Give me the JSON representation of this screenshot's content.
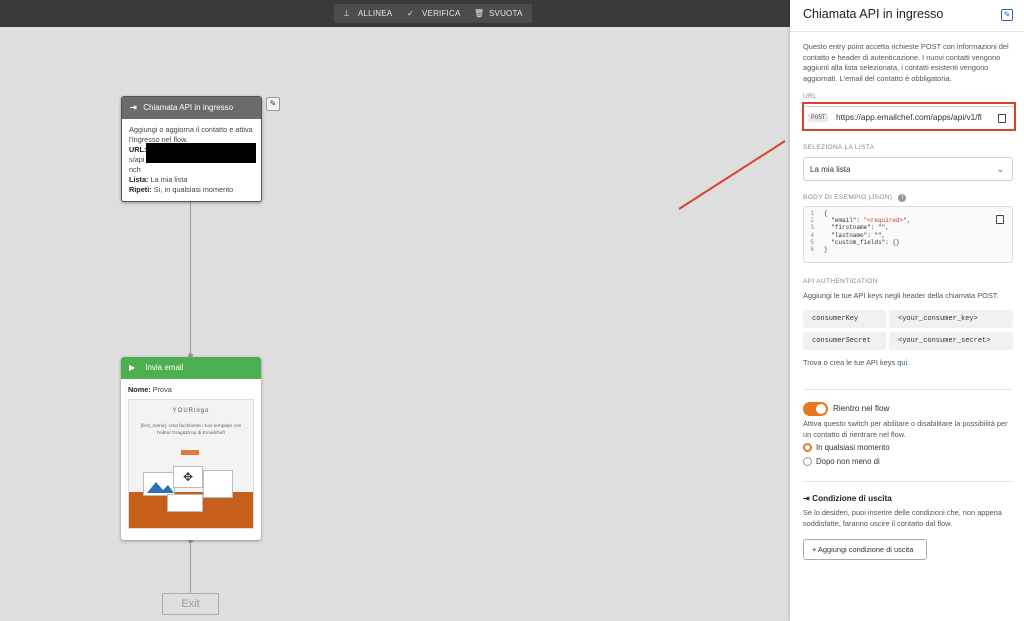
{
  "toolbar": {
    "align_label": "ALLINEA",
    "verify_label": "VERIFICA",
    "clear_label": "SVUOTA"
  },
  "flow": {
    "entry_node": {
      "title": "Chiamata API in ingresso",
      "description": "Aggiungi o aggiorna il contatto e attiva l'ingresso nel flow.",
      "url_label": "URL:",
      "url_partial_1": "s/api",
      "url_partial_2": "nch",
      "list_label": "Lista:",
      "list_value": "La mia lista",
      "repeat_label": "Ripeti:",
      "repeat_value": "Sì, in qualsiasi momento"
    },
    "email_node": {
      "title": "Invia email",
      "name_label": "Nome:",
      "name_value": "Prova",
      "preview": {
        "logo": "YOURlogo",
        "text": "[first_name], crea facilmente i tuoi template con l'editor Drag&Drop di Emailchef!"
      }
    },
    "exit_label": "Exit"
  },
  "panel": {
    "title": "Chiamata API in ingresso",
    "intro": "Questo entry point accetta richieste POST con informazioni del contatto e header di autenticazione. I nuovi contatti vengono aggiunti alla lista selezionata, i contatti esistenti vengono aggiornati. L'email del contatto è obbligatoria.",
    "url_section_label": "URL",
    "method": "POST",
    "url_value": "https://app.emailchef.com/apps/api/v1/fl",
    "list_section_label": "SELEZIONA LA LISTA",
    "list_selected": "La mia lista",
    "body_section_label": "BODY DI ESEMPIO (JSON)",
    "code": {
      "lines": [
        "1",
        "2",
        "3",
        "4",
        "5",
        "6"
      ],
      "l1": "{",
      "l2_key": "  \"email\": ",
      "l2_val": "\"<required>\"",
      "l2_end": ",",
      "l3": "  \"firstname\": \"\",",
      "l4": "  \"lastname\": \"\",",
      "l5": "  \"custom_fields\": {}",
      "l6": "}"
    },
    "auth_section_label": "API AUTHENTICATION",
    "auth_text": "Aggiungi le tue API keys negli header della chiamata POST:",
    "keys": [
      {
        "name": "consumerKey",
        "value": "<your_consumer_key>"
      },
      {
        "name": "consumerSecret",
        "value": "<your_consumer_secret>"
      }
    ],
    "find_keys_text": "Trova o crea le tue API keys ",
    "find_keys_link": "qui",
    "find_keys_end": ".",
    "reentry_label": "Rientro nel flow",
    "reentry_on": true,
    "reentry_text": "Attiva questo switch per abilitare o disabilitare la possibilità per un contatto di rientrare nel flow.",
    "radio_any": "In qualsiasi momento",
    "radio_after": "Dopo non meno di",
    "radio_selected": "In qualsiasi momento",
    "exit_condition_title": "Condizione di uscita",
    "exit_condition_text": "Se lo desideri, puoi inserire delle condizioni che, non appena soddisfatte, faranno uscire il contatto dal flow.",
    "add_exit_button": "Aggiungi condizione di uscita"
  },
  "colors": {
    "accent_orange": "#e87722",
    "annotation_red": "#d4452c",
    "entry_node_header": "#6b6b6b",
    "email_node_header": "#4caf50",
    "link_blue": "#2c5fa8"
  }
}
